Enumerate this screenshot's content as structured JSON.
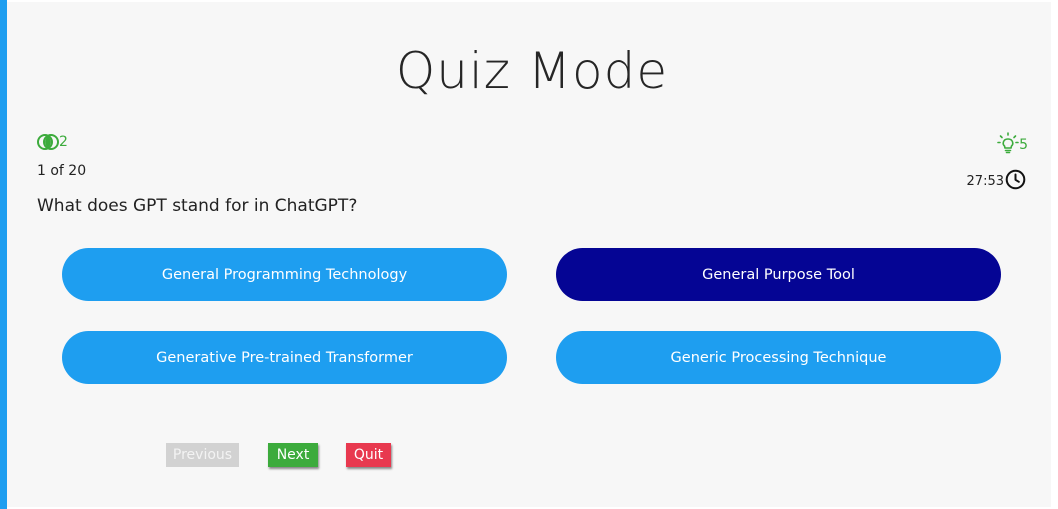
{
  "title": "Quiz Mode",
  "stats": {
    "fifty_fifty_count": "2",
    "hints_count": "5",
    "progress": "1 of 20",
    "timer": "27:53"
  },
  "question": "What does GPT stand for in ChatGPT?",
  "options": [
    "General Programming Technology",
    "General Purpose Tool",
    "Generative Pre-trained Transformer",
    "Generic Processing Technique"
  ],
  "selected_option_index": 1,
  "buttons": {
    "previous": "Previous",
    "next": "Next",
    "quit": "Quit"
  },
  "colors": {
    "accent": "#1e9ef0",
    "selected": "#050594",
    "success": "#3cab3c",
    "danger": "#e8394f",
    "disabled": "#d2d2d2"
  },
  "icons": {
    "lifeline": "fifty-fifty-icon",
    "hint": "lightbulb-icon",
    "timer": "clock-icon"
  }
}
